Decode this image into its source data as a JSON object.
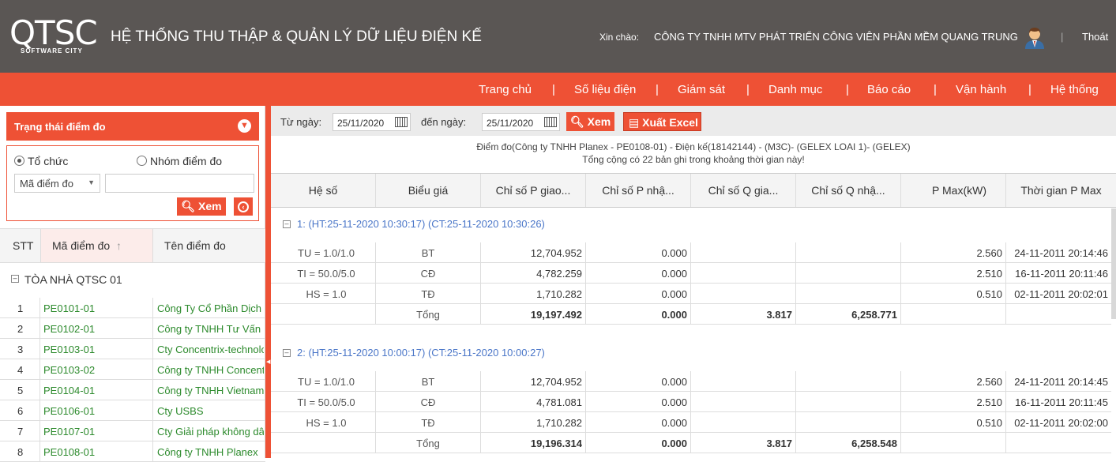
{
  "header": {
    "logo_text": "QTSC",
    "logo_sub": "SOFTWARE CITY",
    "app_title": "HỆ THỐNG THU THẬP & QUẢN LÝ DỮ LIỆU ĐIỆN KẾ",
    "greeting": "Xin chào:",
    "organization": "CÔNG TY TNHH MTV PHÁT TRIỂN CÔNG VIÊN PHẦN MỀM QUANG TRUNG",
    "logout": "Thoát",
    "separator": "|"
  },
  "nav": {
    "items": [
      "Trang chủ",
      "Số liệu điện",
      "Giám sát",
      "Danh mục",
      "Báo cáo",
      "Vận hành",
      "Hệ thống"
    ],
    "separator": "|"
  },
  "left_panel": {
    "title": "Trạng thái điểm đo",
    "radio_org": "Tổ chức",
    "radio_group": "Nhóm điểm đo",
    "select_value": "Mã điểm đo",
    "search_value": "",
    "view_button": "Xem",
    "columns": {
      "stt": "STT",
      "code": "Mã điểm đo",
      "name": "Tên điểm đo"
    },
    "group_name": "TÒA NHÀ QTSC 01",
    "rows": [
      {
        "stt": "1",
        "code": "PE0101-01",
        "name": "Công Ty Cổ Phần Dịch Vụ"
      },
      {
        "stt": "2",
        "code": "PE0102-01",
        "name": "Công ty TNHH Tư Vấn"
      },
      {
        "stt": "3",
        "code": "PE0103-01",
        "name": "Cty Concentrix-technology"
      },
      {
        "stt": "4",
        "code": "PE0103-02",
        "name": "Công ty TNHH Concentrix"
      },
      {
        "stt": "5",
        "code": "PE0104-01",
        "name": "Công ty TNHH Vietnam"
      },
      {
        "stt": "6",
        "code": "PE0106-01",
        "name": "Cty USBS"
      },
      {
        "stt": "7",
        "code": "PE0107-01",
        "name": "Cty Giải pháp không dây"
      },
      {
        "stt": "8",
        "code": "PE0108-01",
        "name": "Công ty TNHH Planex"
      }
    ]
  },
  "toolbar": {
    "from_label": "Từ ngày:",
    "from_value": "25/11/2020",
    "to_label": "đến ngày:",
    "to_value": "25/11/2020",
    "view_button": "Xem",
    "excel_button": "Xuất Excel"
  },
  "info": {
    "line1": "Điểm đo(Công ty TNHH Planex - PE0108-01) - Điện kế(18142144) - (M3C)- (GELEX LOAI 1)- (GELEX)",
    "line2": "Tổng cộng có 22 bản ghi trong khoảng thời gian này!"
  },
  "grid": {
    "columns": [
      "Hệ số",
      "Biểu giá",
      "Chỉ số P giao nhận",
      "Chỉ số P nhận giao",
      "Chỉ số Q giao nhận",
      "Chỉ số Q nhận giao",
      "P Max(kW)",
      "Thời gian P Max"
    ],
    "column_display": [
      "Hệ số",
      "Biểu giá",
      "Chỉ số P giao...",
      "Chỉ số P nhậ...",
      "Chỉ số Q gia...",
      "Chỉ số Q nhậ...",
      "P Max(kW)",
      "Thời gian P Max"
    ],
    "groups": [
      {
        "label": "1:   (HT:25-11-2020 10:30:17)   (CT:25-11-2020 10:30:26)",
        "rows": [
          {
            "k": "TU = 1.0/1.0",
            "b": "BT",
            "p1": "12,704.952",
            "p2": "0.000",
            "q1": "",
            "q2": "",
            "pm": "2.560",
            "tm": "24-11-2011 20:14:46"
          },
          {
            "k": "TI = 50.0/5.0",
            "b": "CĐ",
            "p1": "4,782.259",
            "p2": "0.000",
            "q1": "",
            "q2": "",
            "pm": "2.510",
            "tm": "16-11-2011 20:11:46"
          },
          {
            "k": "HS = 1.0",
            "b": "TĐ",
            "p1": "1,710.282",
            "p2": "0.000",
            "q1": "",
            "q2": "",
            "pm": "0.510",
            "tm": "02-11-2011 20:02:01"
          },
          {
            "k": "",
            "b": "Tổng",
            "p1": "19,197.492",
            "p2": "0.000",
            "q1": "3.817",
            "q2": "6,258.771",
            "pm": "",
            "tm": ""
          }
        ]
      },
      {
        "label": "2:   (HT:25-11-2020 10:00:17)   (CT:25-11-2020 10:00:27)",
        "rows": [
          {
            "k": "TU = 1.0/1.0",
            "b": "BT",
            "p1": "12,704.952",
            "p2": "0.000",
            "q1": "",
            "q2": "",
            "pm": "2.560",
            "tm": "24-11-2011 20:14:45"
          },
          {
            "k": "TI = 50.0/5.0",
            "b": "CĐ",
            "p1": "4,781.081",
            "p2": "0.000",
            "q1": "",
            "q2": "",
            "pm": "2.510",
            "tm": "16-11-2011 20:11:45"
          },
          {
            "k": "HS = 1.0",
            "b": "TĐ",
            "p1": "1,710.282",
            "p2": "0.000",
            "q1": "",
            "q2": "",
            "pm": "0.510",
            "tm": "02-11-2011 20:02:00"
          },
          {
            "k": "",
            "b": "Tổng",
            "p1": "19,196.314",
            "p2": "0.000",
            "q1": "3.817",
            "q2": "6,258.548",
            "pm": "",
            "tm": ""
          }
        ]
      }
    ]
  },
  "colors": {
    "accent": "#ee5135",
    "header_bg": "#5a5654",
    "link_green": "#2c8a2c",
    "group_blue": "#4a76c8"
  },
  "icons": [
    "search-icon",
    "calendar-icon",
    "excel-icon",
    "collapse-icon",
    "back-icon",
    "user-avatar-icon",
    "sort-arrow-icon"
  ]
}
